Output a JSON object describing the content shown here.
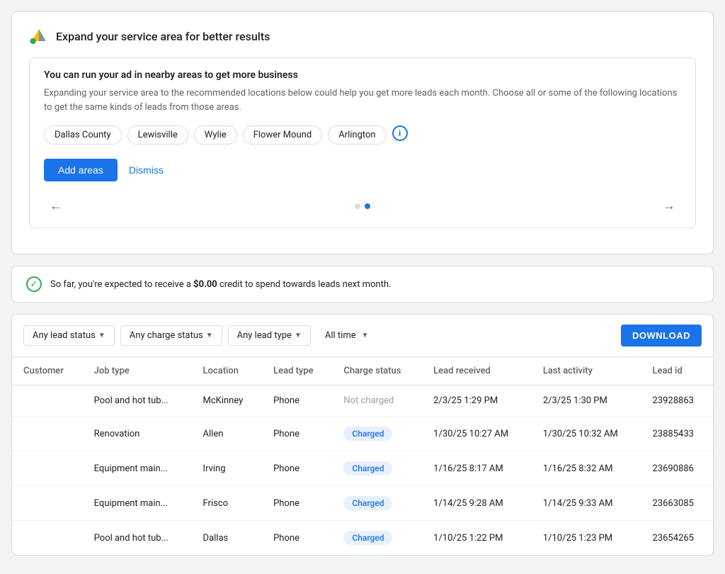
{
  "expand_card": {
    "title": "Expand your service area for better results",
    "info_box": {
      "title": "You can run your ad in nearby areas to get more business",
      "description": "Expanding your service area to the recommended locations below could help you get more leads each month. Choose all or some of the following locations to get the same kinds of leads from those areas."
    },
    "locations": [
      {
        "label": "Dallas County"
      },
      {
        "label": "Lewisville"
      },
      {
        "label": "Wylie"
      },
      {
        "label": "Flower Mound"
      },
      {
        "label": "Arlington"
      }
    ],
    "add_areas_label": "Add areas",
    "dismiss_label": "Dismiss",
    "pagination": {
      "dots": [
        false,
        true
      ],
      "prev_arrow": "←",
      "next_arrow": "→"
    }
  },
  "credit_notice": {
    "text_prefix": "So far, you're expected to receive a ",
    "amount": "$0.00",
    "text_suffix": " credit to spend towards leads next month."
  },
  "leads_table": {
    "filters": [
      {
        "label": "Any lead status",
        "id": "lead-status-filter"
      },
      {
        "label": "Any charge status",
        "id": "charge-status-filter"
      },
      {
        "label": "Any lead type",
        "id": "lead-type-filter"
      },
      {
        "label": "All time",
        "id": "time-filter"
      }
    ],
    "download_label": "DOWNLOAD",
    "columns": [
      "Customer",
      "Job type",
      "Location",
      "Lead type",
      "Charge status",
      "Lead received",
      "Last activity",
      "Lead id"
    ],
    "rows": [
      {
        "customer": "",
        "job_type": "Pool and hot tub...",
        "location": "McKinney",
        "lead_type": "Phone",
        "charge_status": "Not charged",
        "charge_status_type": "not-charged",
        "lead_received": "2/3/25 1:29 PM",
        "last_activity": "2/3/25 1:30 PM",
        "lead_id": "23928863"
      },
      {
        "customer": "",
        "job_type": "Renovation",
        "location": "Allen",
        "lead_type": "Phone",
        "charge_status": "Charged",
        "charge_status_type": "charged",
        "lead_received": "1/30/25 10:27 AM",
        "last_activity": "1/30/25 10:32 AM",
        "lead_id": "23885433"
      },
      {
        "customer": "",
        "job_type": "Equipment main...",
        "location": "Irving",
        "lead_type": "Phone",
        "charge_status": "Charged",
        "charge_status_type": "charged",
        "lead_received": "1/16/25 8:17 AM",
        "last_activity": "1/16/25 8:32 AM",
        "lead_id": "23690886"
      },
      {
        "customer": "",
        "job_type": "Equipment main...",
        "location": "Frisco",
        "lead_type": "Phone",
        "charge_status": "Charged",
        "charge_status_type": "charged",
        "lead_received": "1/14/25 9:28 AM",
        "last_activity": "1/14/25 9:33 AM",
        "lead_id": "23663085"
      },
      {
        "customer": "",
        "job_type": "Pool and hot tub...",
        "location": "Dallas",
        "lead_type": "Phone",
        "charge_status": "Charged",
        "charge_status_type": "charged",
        "lead_received": "1/10/25 1:22 PM",
        "last_activity": "1/10/25 1:23 PM",
        "lead_id": "23654265"
      }
    ]
  }
}
